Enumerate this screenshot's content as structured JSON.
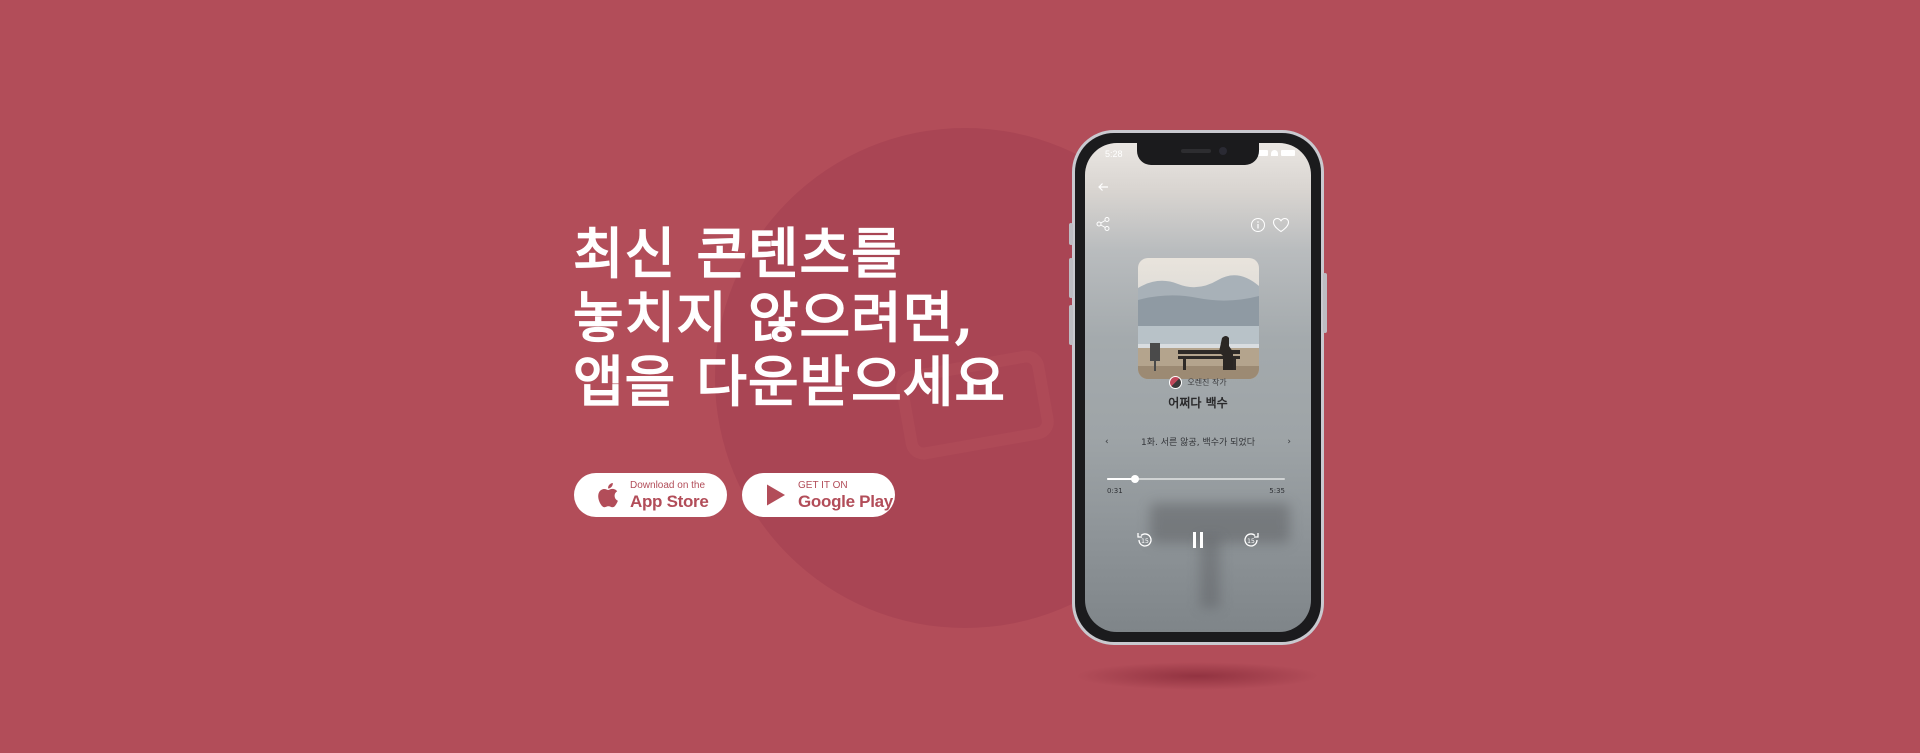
{
  "headline": {
    "lines": [
      "최신 콘텐츠를",
      "놓치지 않으려면,",
      "앱을 다운받으세요"
    ]
  },
  "store_buttons": {
    "apple": {
      "small": "Download on the",
      "big": "App Store",
      "icon": "apple-icon"
    },
    "google": {
      "small": "GET IT ON",
      "big": "Google Play",
      "icon": "play-icon"
    }
  },
  "phone": {
    "status_time": "5:28",
    "header_icons": [
      "back-arrow-icon",
      "share-icon",
      "info-icon",
      "heart-icon"
    ],
    "author": "오렌진 작가",
    "title": "어쩌다 백수",
    "episode_title": "1화. 서른 앓공, 백수가 되었다",
    "current_time": "0:31",
    "total_time": "5:35",
    "progress_fraction": 0.16,
    "controls": [
      "rewind-15-icon",
      "pause-icon",
      "forward-15-icon"
    ]
  },
  "colors": {
    "background": "#b24d59",
    "accent": "#b24d59",
    "text_white": "#ffffff"
  }
}
